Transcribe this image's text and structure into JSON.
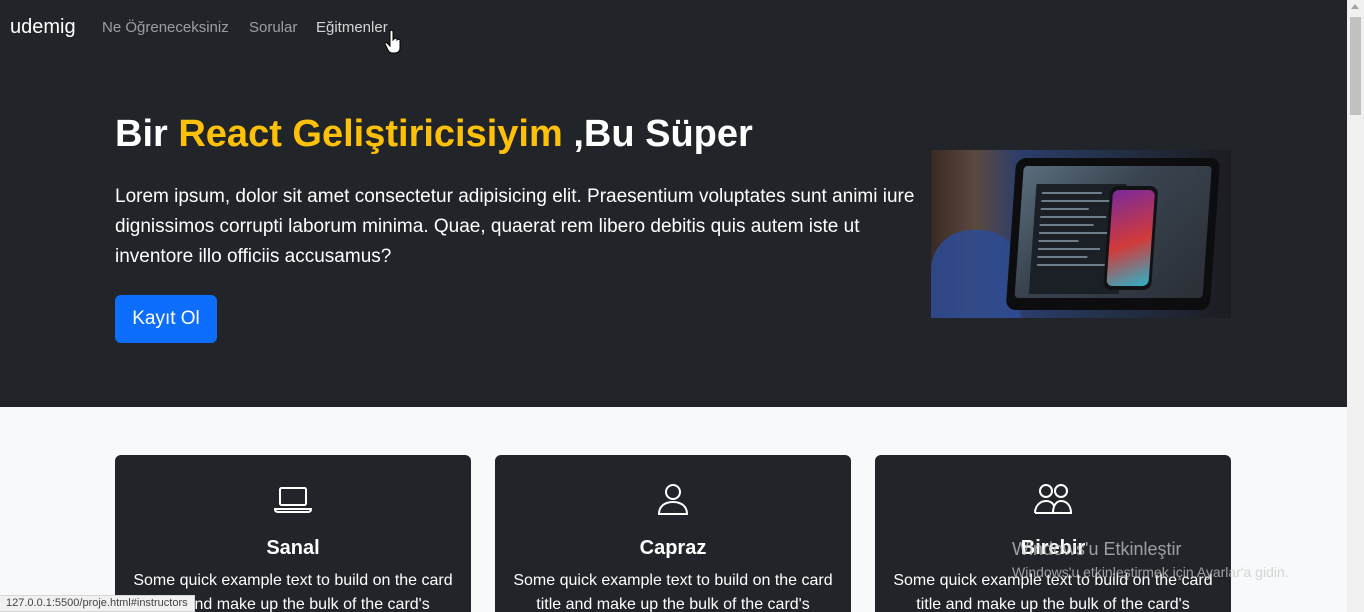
{
  "navbar": {
    "brand": "udemig",
    "links": [
      "Ne Öğreneceksiniz",
      "Sorular",
      "Eğitmenler"
    ]
  },
  "hero": {
    "title_pre": "Bir ",
    "title_accent": "React Geliştiricisiyim",
    "title_post": " ,Bu Süper",
    "text": "Lorem ipsum, dolor sit amet consectetur adipisicing elit. Praesentium voluptates sunt animi iure dignissimos corrupti laborum minima. Quae, quaerat rem libero debitis quis autem iste ut inventore illo officiis accusamus?",
    "button": "Kayıt Ol"
  },
  "cards": [
    {
      "icon": "laptop-icon",
      "title": "Sanal",
      "text": "Some quick example text to build on the card title and make up the bulk of the card's"
    },
    {
      "icon": "person-icon",
      "title": "Capraz",
      "text": "Some quick example text to build on the card title and make up the bulk of the card's"
    },
    {
      "icon": "people-icon",
      "title": "Birebir",
      "text": "Some quick example text to build on the card title and make up the bulk of the card's"
    }
  ],
  "status_url": "127.0.0.1:5500/proje.html#instructors",
  "watermark": {
    "title": "Windows'u Etkinleştir",
    "subtitle": "Windows'u etkinleştirmek için Ayarlar'a gidin."
  },
  "colors": {
    "dark": "#212529",
    "accent": "#ffc107",
    "primary": "#0d6efd"
  }
}
